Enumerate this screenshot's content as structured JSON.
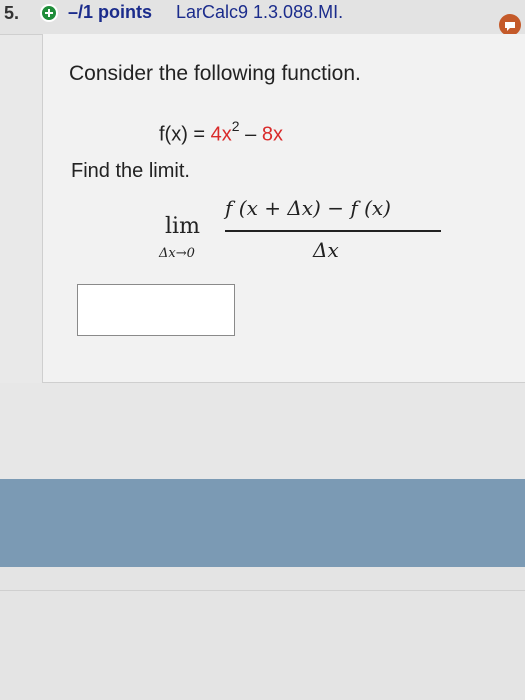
{
  "header": {
    "question_number": "5.",
    "points_label": "–/1 points",
    "course_label": "LarCalc9 1.3.088.MI.",
    "plus_icon": "plus-circle-icon",
    "note_icon": "note-icon"
  },
  "question": {
    "intro": "Consider the following function.",
    "function_prefix": "f(x) = ",
    "function_term1": "4x",
    "function_exponent": "2",
    "function_minus": " – ",
    "function_term2": "8x",
    "instruction": "Find the limit.",
    "limit_word": "lim",
    "limit_sub": "Δx→0",
    "numerator": "f (x + Δx) − f (x)",
    "denominator": "Δx",
    "answer_value": ""
  },
  "colors": {
    "header_text": "#1b2c8c",
    "highlight_red": "#d92a2a",
    "plus_green": "#1f8d3a",
    "note_orange": "#c45a2a",
    "blue_band": "#7b9ab4"
  }
}
